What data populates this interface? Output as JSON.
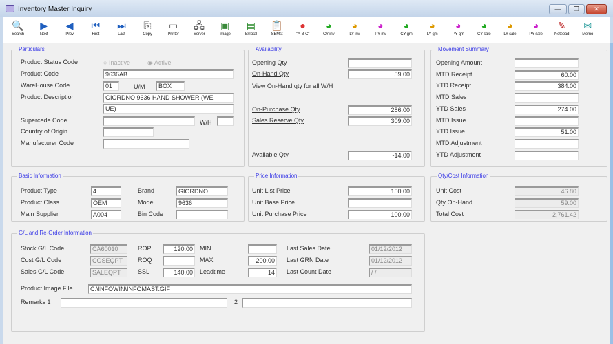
{
  "window": {
    "title": "Inventory Master Inquiry",
    "minimize": "—",
    "restore": "❐",
    "close": "✕"
  },
  "toolbar": [
    {
      "label": "Search",
      "icon": "search-icon",
      "glyph": "🔍",
      "color": "#335"
    },
    {
      "label": "Next",
      "icon": "next-icon",
      "glyph": "▶",
      "color": "#1f5fbf"
    },
    {
      "label": "Prev",
      "icon": "prev-icon",
      "glyph": "◀",
      "color": "#1f5fbf"
    },
    {
      "label": "First",
      "icon": "first-icon",
      "glyph": "⏮",
      "color": "#1f5fbf"
    },
    {
      "label": "Last",
      "icon": "last-icon",
      "glyph": "⏭",
      "color": "#1f5fbf"
    },
    {
      "label": "Copy",
      "icon": "copy-icon",
      "glyph": "⎘",
      "color": "#666"
    },
    {
      "label": "Printer",
      "icon": "printer-icon",
      "glyph": "▭",
      "color": "#444"
    },
    {
      "label": "Server",
      "icon": "server-icon",
      "glyph": "🖧",
      "color": "#444"
    },
    {
      "label": "Image",
      "icon": "image-icon",
      "glyph": "▣",
      "color": "#3a8a3a"
    },
    {
      "label": "B/Total",
      "icon": "btotal-icon",
      "glyph": "▤",
      "color": "#2a8a2a"
    },
    {
      "label": "SBMst",
      "icon": "clipboard-icon",
      "glyph": "📋",
      "color": "#556"
    },
    {
      "label": "\"A-B-C\"",
      "icon": "abc-icon",
      "glyph": "●",
      "color": "#d33"
    },
    {
      "label": "CY inv",
      "icon": "cy-inv-icon",
      "glyph": "◕",
      "color": "#2a2"
    },
    {
      "label": "LY inv",
      "icon": "ly-inv-icon",
      "glyph": "◕",
      "color": "#d90"
    },
    {
      "label": "PY inv",
      "icon": "py-inv-icon",
      "glyph": "◕",
      "color": "#c2c"
    },
    {
      "label": "CY gm",
      "icon": "cy-gm-icon",
      "glyph": "◕",
      "color": "#2a2"
    },
    {
      "label": "LY gm",
      "icon": "ly-gm-icon",
      "glyph": "◕",
      "color": "#d90"
    },
    {
      "label": "PY gm",
      "icon": "py-gm-icon",
      "glyph": "◕",
      "color": "#c2c"
    },
    {
      "label": "CY sale",
      "icon": "cy-sale-icon",
      "glyph": "◕",
      "color": "#2a2"
    },
    {
      "label": "LY sale",
      "icon": "ly-sale-icon",
      "glyph": "◕",
      "color": "#d90"
    },
    {
      "label": "PY sale",
      "icon": "py-sale-icon",
      "glyph": "◕",
      "color": "#c2c"
    },
    {
      "label": "Notepad",
      "icon": "notepad-icon",
      "glyph": "✎",
      "color": "#b22"
    },
    {
      "label": "Memo",
      "icon": "memo-icon",
      "glyph": "✉",
      "color": "#299"
    }
  ],
  "particulars": {
    "title": "Particulars",
    "status_label": "Product Status Code",
    "inactive": "Inactive",
    "active": "Active",
    "status_selected": "Active",
    "product_code_label": "Product Code",
    "product_code": "9636AB",
    "warehouse_label": "WareHouse Code",
    "warehouse": "01",
    "uom_label": "U/M",
    "uom": "BOX",
    "desc_label": "Product Description",
    "desc1": "GIORDNO 9636 HAND SHOWER (WE",
    "desc2": "UE)",
    "supercede_label": "Supercede Code",
    "supercede": "",
    "wh_label": "W/H",
    "wh": "",
    "country_label": "Country of Origin",
    "country": "",
    "manufacturer_label": "Manufacturer Code",
    "manufacturer": ""
  },
  "availability": {
    "title": "Availability",
    "opening_label": "Opening Qty",
    "opening": "",
    "onhand_label": "On-Hand Qty",
    "onhand": "59.00",
    "view_link": "View On-Hand qty for all W/H",
    "onpurchase_label": "On-Purchase Qty",
    "onpurchase": "286.00",
    "salesreserve_label": "Sales Reserve Qty",
    "salesreserve": "309.00",
    "available_label": "Available Qty",
    "available": "-14.00"
  },
  "movement": {
    "title": "Movement Summary",
    "rows": [
      {
        "label": "Opening Amount",
        "value": ""
      },
      {
        "label": "MTD Receipt",
        "value": "60.00"
      },
      {
        "label": "YTD Receipt",
        "value": "384.00"
      },
      {
        "label": "MTD Sales",
        "value": ""
      },
      {
        "label": "YTD Sales",
        "value": "274.00"
      },
      {
        "label": "MTD Issue",
        "value": ""
      },
      {
        "label": "YTD Issue",
        "value": "51.00"
      },
      {
        "label": "MTD Adjustment",
        "value": ""
      },
      {
        "label": "YTD Adjustment",
        "value": ""
      }
    ]
  },
  "basic": {
    "title": "Basic Information",
    "type_label": "Product Type",
    "type": "4",
    "class_label": "Product Class",
    "class": "OEM",
    "supplier_label": "Main Supplier",
    "supplier": "A004",
    "brand_label": "Brand",
    "brand": "GIORDNO",
    "model_label": "Model",
    "model": "9636",
    "bin_label": "Bin Code",
    "bin": ""
  },
  "price": {
    "title": "Price Information",
    "list_label": "Unit List Price",
    "list": "150.00",
    "base_label": "Unit Base Price",
    "base": "",
    "purchase_label": "Unit Purchase Price",
    "purchase": "100.00"
  },
  "qtycost": {
    "title": "Qty/Cost Information",
    "unitcost_label": "Unit Cost",
    "unitcost": "46.80",
    "qty_label": "Qty On-Hand",
    "qty": "59.00",
    "total_label": "Total Cost",
    "total": "2,761.42"
  },
  "gl": {
    "title": "G/L and Re-Order Information",
    "stock_label": "Stock G/L Code",
    "stock": "CA60010",
    "cost_label": "Cost G/L Code",
    "cost": "COSEQPT",
    "sales_label": "Sales G/L Code",
    "sales": "SALEQPT",
    "rop_label": "ROP",
    "rop": "120.00",
    "roq_label": "ROQ",
    "roq": "",
    "ssl_label": "SSL",
    "ssl": "140.00",
    "min_label": "MIN",
    "min": "",
    "max_label": "MAX",
    "max": "200.00",
    "lead_label": "Leadtime",
    "lead": "14",
    "lastsales_label": "Last Sales Date",
    "lastsales": "01/12/2012",
    "lastgrn_label": "Last GRN Date",
    "lastgrn": "01/12/2012",
    "lastcount_label": "Last Count Date",
    "lastcount": "/ /",
    "image_label": "Product Image File",
    "image": "C:\\INFOWIN\\INFOMAST.GIF",
    "remarks1_label": "Remarks 1",
    "remarks1": "",
    "remarks2_label": "2",
    "remarks2": ""
  }
}
